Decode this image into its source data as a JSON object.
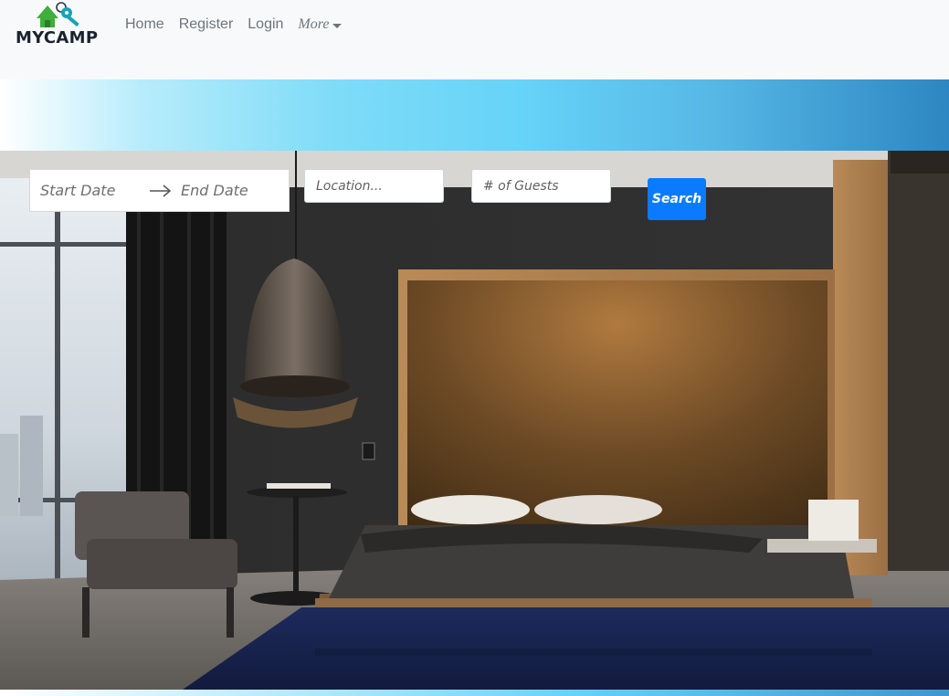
{
  "brand": {
    "name": "MYCAMP"
  },
  "nav": {
    "links": [
      {
        "label": "Home"
      },
      {
        "label": "Register"
      },
      {
        "label": "Login"
      }
    ],
    "more_label": "More"
  },
  "search": {
    "start_date_placeholder": "Start Date",
    "end_date_placeholder": "End Date",
    "location_placeholder": "Location...",
    "guests_placeholder": "# of Guests",
    "button_label": "Search"
  },
  "colors": {
    "navbar_bg": "#f8f9fa",
    "accent": "#0a7bff",
    "logo_green": "#3fae3a",
    "logo_teal": "#19a3b8"
  },
  "icons": {
    "logo": "house-key-icon",
    "date_separator": "arrow-right-icon",
    "more": "caret-down-icon"
  }
}
